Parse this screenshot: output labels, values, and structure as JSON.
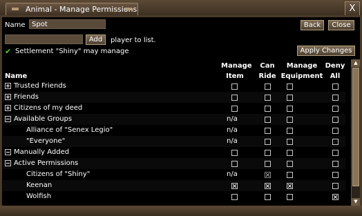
{
  "window": {
    "title": "Animal - Manage Permissions",
    "close_glyph": "X"
  },
  "header": {
    "name_label": "Name",
    "name_value": "Spot",
    "back_label": "Back",
    "close_label": "Close",
    "add_input_value": "",
    "add_label": "Add",
    "add_suffix": "player to list.",
    "settlement_text": "Settlement \"Shiny\" may manage",
    "apply_label": "Apply Changes"
  },
  "table": {
    "name_header": "Name",
    "columns": [
      {
        "line1": "Manage",
        "line2": "Item"
      },
      {
        "line1": "Can",
        "line2": "Ride"
      },
      {
        "line1": "Manage",
        "line2": "Equipment"
      },
      {
        "line1": "Deny",
        "line2": "All"
      }
    ],
    "rows": [
      {
        "label": "Trusted Friends",
        "expander": "plus",
        "indent": 0,
        "cells": [
          "box",
          "box",
          "box",
          "box"
        ]
      },
      {
        "label": "Friends",
        "expander": "plus",
        "indent": 0,
        "cells": [
          "box",
          "box",
          "box",
          "box"
        ]
      },
      {
        "label": "Citizens of my deed",
        "expander": "plus",
        "indent": 0,
        "cells": [
          "box",
          "box",
          "box",
          "box"
        ]
      },
      {
        "label": "Available Groups",
        "expander": "minus",
        "indent": 0,
        "cells": [
          "n/a",
          "box",
          "box",
          "box"
        ]
      },
      {
        "label": "Alliance of \"Senex Legio\"",
        "expander": "none",
        "indent": 2,
        "cells": [
          "n/a",
          "box",
          "box",
          "box"
        ]
      },
      {
        "label": "\"Everyone\"",
        "expander": "none",
        "indent": 2,
        "cells": [
          "n/a",
          "box",
          "box",
          "box"
        ]
      },
      {
        "label": "Manually Added",
        "expander": "box",
        "indent": 0,
        "cells": [
          "box",
          "box",
          "box",
          "box"
        ]
      },
      {
        "label": "Active Permissions",
        "expander": "minus",
        "indent": 0,
        "cells": [
          "box",
          "box",
          "box",
          "box"
        ]
      },
      {
        "label": "Citizens of \"Shiny\"",
        "expander": "none",
        "indent": 2,
        "cells": [
          "n/a",
          "x-disabled",
          "box",
          "box"
        ]
      },
      {
        "label": "Keenan",
        "expander": "none",
        "indent": 2,
        "cells": [
          "x",
          "x",
          "x",
          "box"
        ]
      },
      {
        "label": "Wolfish",
        "expander": "none",
        "indent": 2,
        "cells": [
          "box",
          "box",
          "box",
          "x"
        ]
      }
    ]
  },
  "scrollbar": {
    "up_glyph": "▲",
    "down_glyph": "▼"
  },
  "colors": {
    "accent_check": "#4fd02f",
    "frame": "#4a3a2a"
  }
}
